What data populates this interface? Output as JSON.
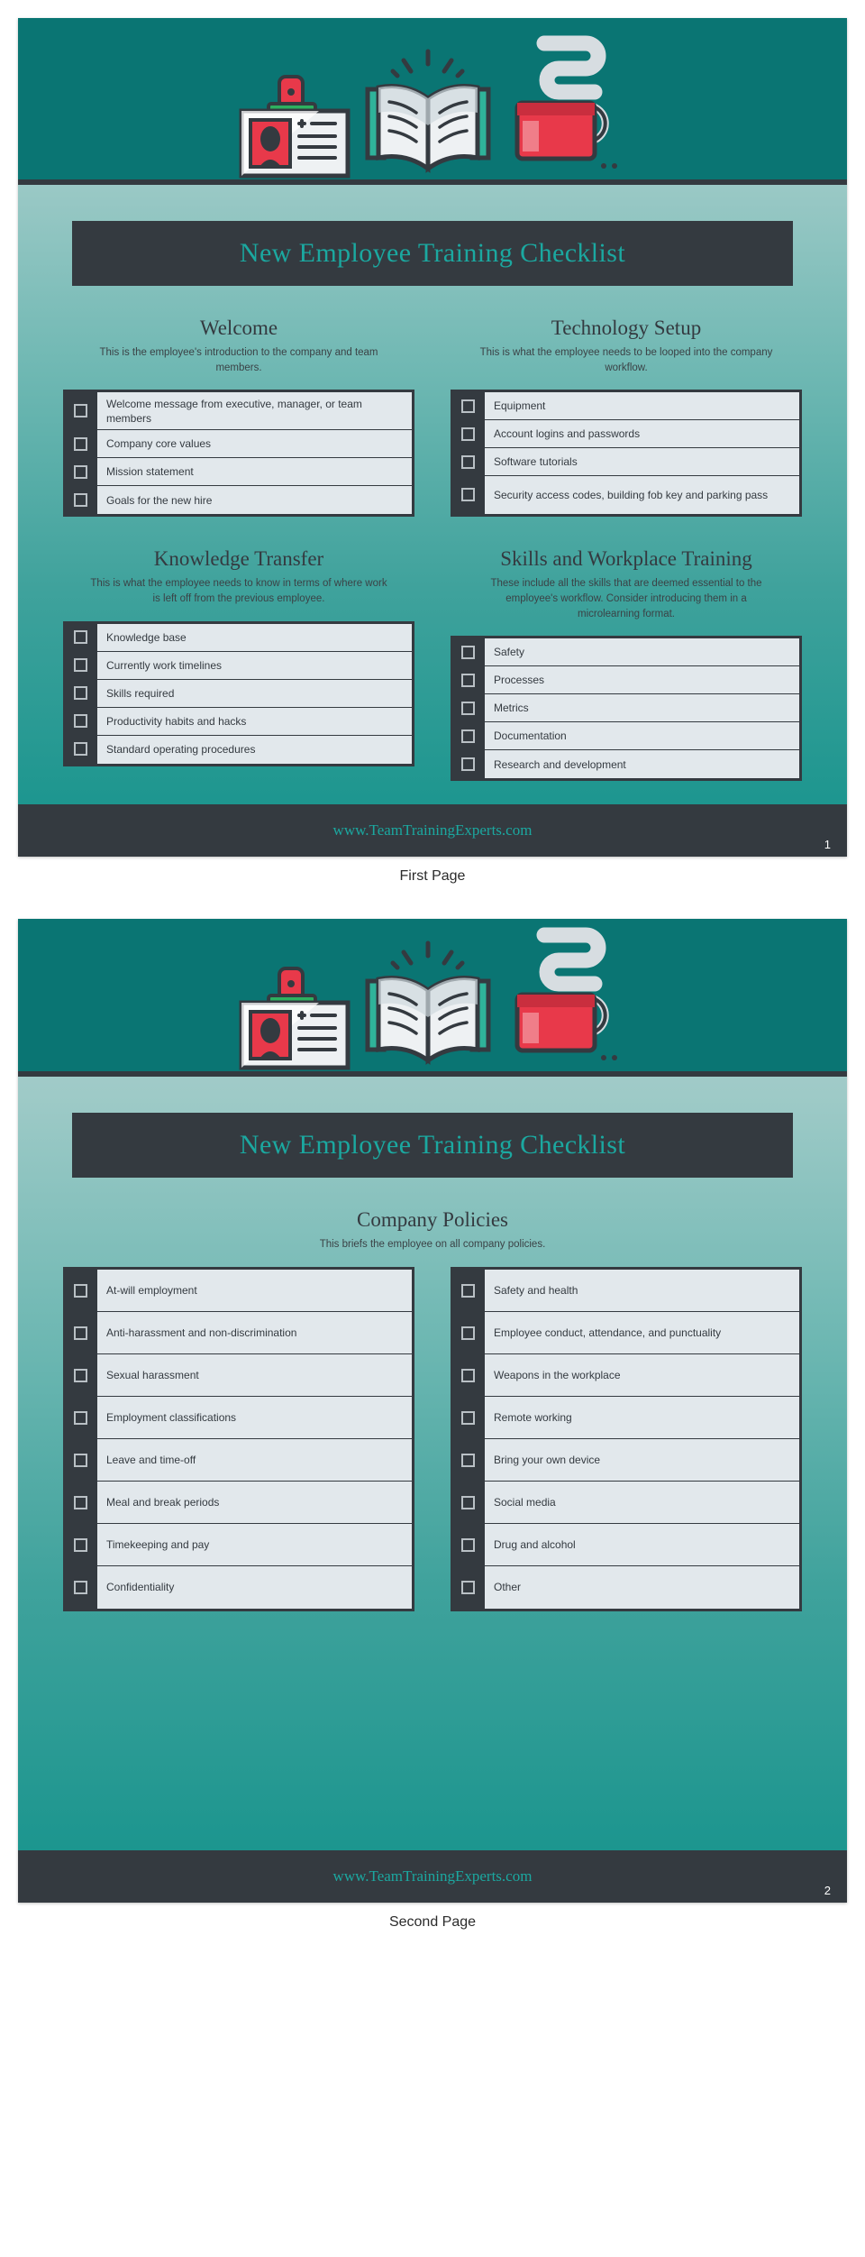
{
  "title": "New Employee Training Checklist",
  "footer": {
    "url": "www.TeamTrainingExperts.com"
  },
  "captions": {
    "page1": "First Page",
    "page2": "Second Page"
  },
  "colors": {
    "header_teal": "#0a7573",
    "dark": "#343a40",
    "accent_teal": "#1ba8a0",
    "row_bg": "#e2e8ec",
    "red": "#e8394a",
    "green": "#2db15f"
  },
  "illustration": {
    "items": [
      "id-badge-icon",
      "open-book-icon",
      "coffee-cup-icon"
    ]
  },
  "page1": {
    "number": "1",
    "sections": [
      {
        "heading": "Welcome",
        "subtitle": "This is the employee's introduction to the company and team members.",
        "items": [
          "Welcome message from executive, manager, or team members",
          "Company core values",
          "Mission statement",
          "Goals for the new hire"
        ]
      },
      {
        "heading": "Technology Setup",
        "subtitle": "This is what the employee needs to be looped into the company workflow.",
        "items": [
          "Equipment",
          "Account logins and passwords",
          "Software tutorials",
          "Security access codes, building fob key and parking pass"
        ]
      },
      {
        "heading": "Knowledge Transfer",
        "subtitle": "This is what the employee needs to know in terms of where work is left off from the previous employee.",
        "items": [
          "Knowledge base",
          "Currently work timelines",
          "Skills required",
          "Productivity habits and hacks",
          "Standard operating procedures"
        ]
      },
      {
        "heading": "Skills and Workplace Training",
        "subtitle": "These include all the skills that are deemed essential to the employee's workflow. Consider introducing them in a microlearning format.",
        "items": [
          "Safety",
          "Processes",
          "Metrics",
          "Documentation",
          "Research and development"
        ]
      }
    ]
  },
  "page2": {
    "number": "2",
    "section": {
      "heading": "Company Policies",
      "subtitle": "This briefs the employee on all company policies."
    },
    "left_items": [
      "At-will employment",
      "Anti-harassment and non-discrimination",
      "Sexual harassment",
      "Employment classifications",
      "Leave and time-off",
      "Meal and break periods",
      "Timekeeping and pay",
      "Confidentiality"
    ],
    "right_items": [
      "Safety and health",
      "Employee conduct, attendance, and punctuality",
      "Weapons in the workplace",
      "Remote working",
      "Bring your own device",
      "Social media",
      "Drug and alcohol",
      "Other"
    ]
  }
}
